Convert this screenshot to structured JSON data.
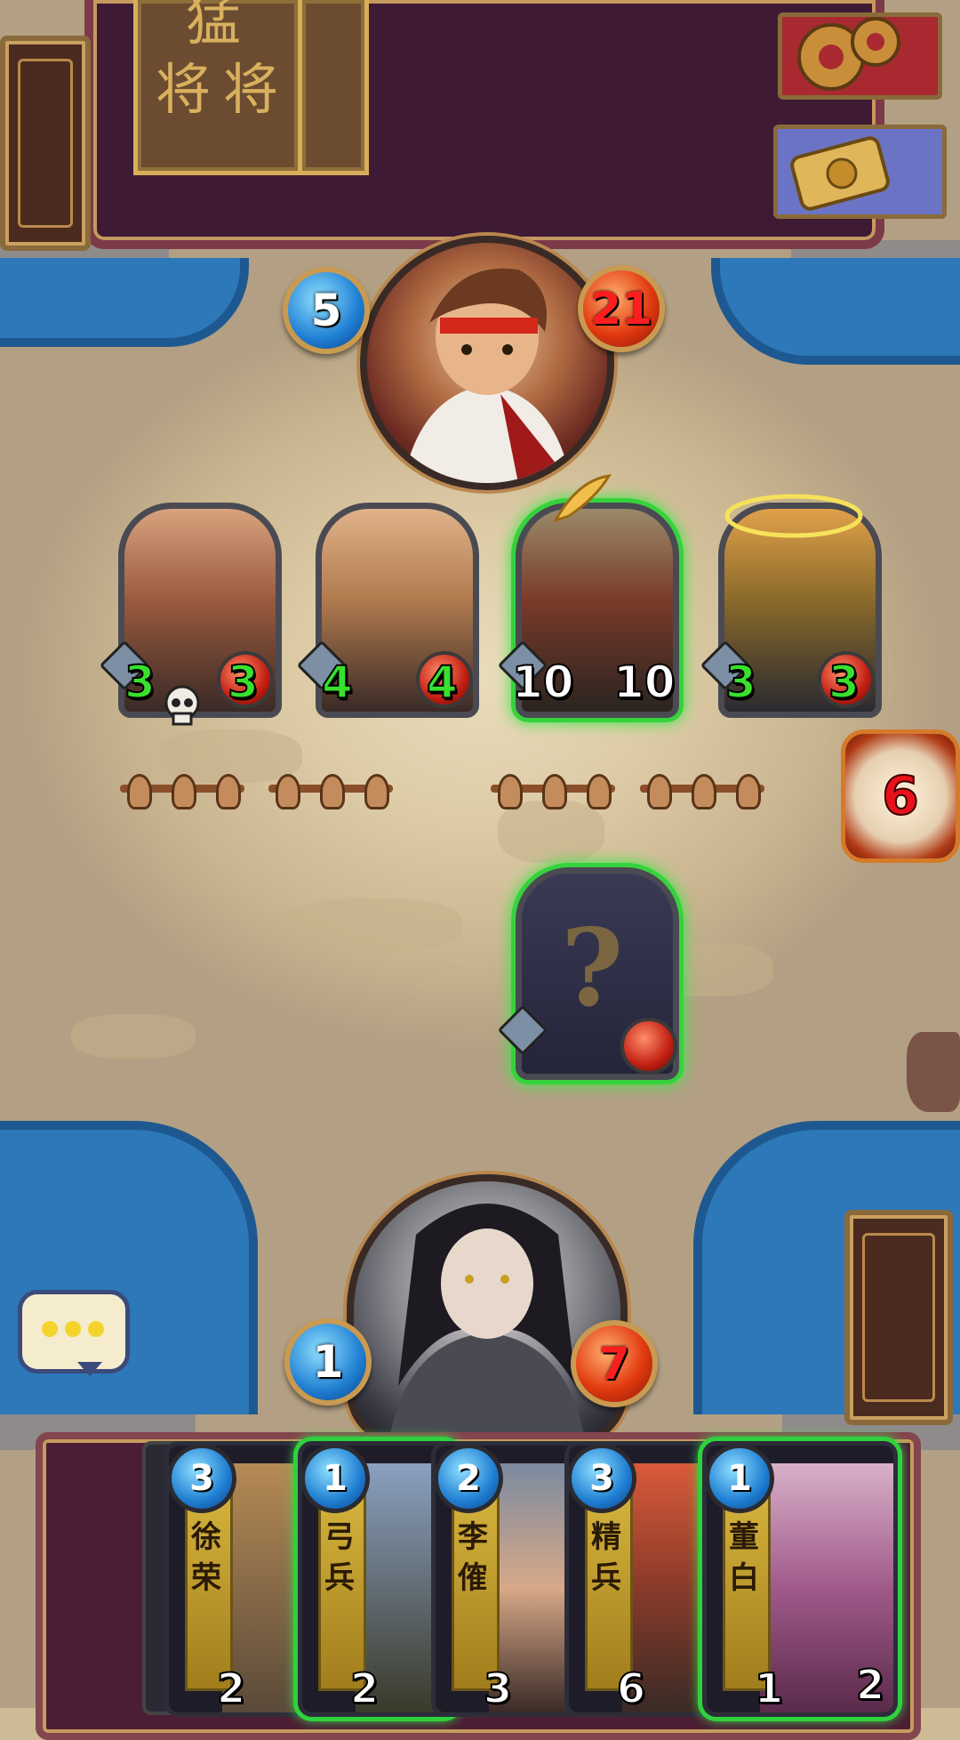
{
  "opponent": {
    "mana": "5",
    "health": "21",
    "hand_banner_glyphs": [
      "猛",
      "将",
      "将"
    ]
  },
  "opponent_board": {
    "minions": [
      {
        "attack": "3",
        "health": "3",
        "status": "skull",
        "ready": false,
        "tone": "#7a4a3a"
      },
      {
        "attack": "4",
        "health": "4",
        "status": "",
        "ready": false,
        "tone": "#8a5a3a"
      },
      {
        "attack": "10",
        "health": "10",
        "status": "feather",
        "ready": true,
        "tone": "#5a4a3a"
      },
      {
        "attack": "3",
        "health": "3",
        "status": "halo",
        "ready": false,
        "tone": "#8a6a2a"
      }
    ]
  },
  "turn_counter": "6",
  "played_card": {
    "label": "?",
    "ready": true
  },
  "player": {
    "mana": "1",
    "health": "7"
  },
  "hand": {
    "cards": [
      {
        "name": "徐荣",
        "cost": "3",
        "attack": "2",
        "health": "",
        "playable": false
      },
      {
        "name": "弓兵",
        "cost": "1",
        "attack": "2",
        "health": "",
        "playable": true
      },
      {
        "name": "李傕",
        "cost": "2",
        "attack": "3",
        "health": "",
        "playable": false
      },
      {
        "name": "精兵",
        "cost": "3",
        "attack": "6",
        "health": "",
        "playable": false
      },
      {
        "name": "董白",
        "cost": "1",
        "attack": "1",
        "health": "2",
        "playable": true
      }
    ]
  },
  "colors": {
    "mana_blue": "#1f7ed2",
    "health_red": "#e23a10",
    "ready_glow": "#36d23c",
    "stat_green": "#37e12c"
  },
  "icons": [
    "settings-gear-icon",
    "quest-scroll-icon",
    "chat-bubble-icon",
    "deck-icon",
    "skull-icon"
  ]
}
